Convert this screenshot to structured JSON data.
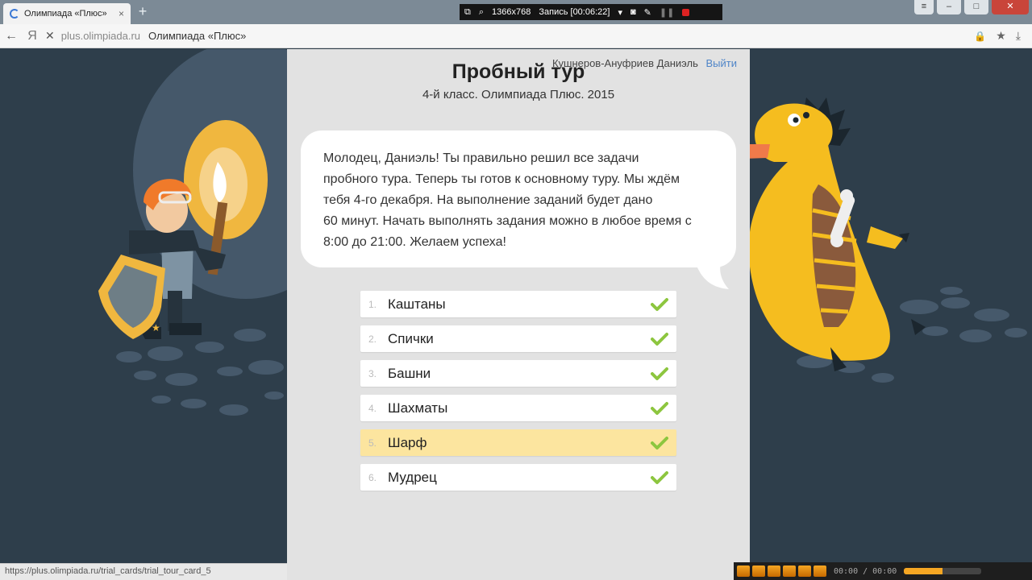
{
  "browser": {
    "tab_title": "Олимпиада «Плюс»",
    "tab_close": "×",
    "new_tab": "+",
    "url_domain": "plus.olimpiada.ru",
    "url_title": "Олимпиада «Плюс»",
    "yandex_letter": "Я",
    "status_url": "https://plus.olimpiada.ru/trial_cards/trial_tour_card_5"
  },
  "recorder": {
    "resolution": "1366x768",
    "recording": "Запись [00:06:22]"
  },
  "page": {
    "title": "Пробный тур",
    "subtitle": "4-й класс. Олимпиада Плюс. 2015",
    "user_name": "Кушнеров-Ануфриев Даниэль",
    "logout": "Выйти",
    "message_lines": [
      "Молодец, Даниэль! Ты правильно решил все задачи",
      "пробного тура. Теперь ты готов к основному туру. Мы ждём",
      "тебя 4-го декабря. На выполнение заданий будет дано",
      "60 минут. Начать выполнять задания можно в любое время с",
      "8:00 до 21:00. Желаем успеха!"
    ],
    "tasks": [
      {
        "num": "1.",
        "name": "Каштаны"
      },
      {
        "num": "2.",
        "name": "Спички"
      },
      {
        "num": "3.",
        "name": "Башни"
      },
      {
        "num": "4.",
        "name": "Шахматы"
      },
      {
        "num": "5.",
        "name": "Шарф"
      },
      {
        "num": "6.",
        "name": "Мудрец"
      }
    ]
  },
  "player": {
    "time": "00:00 / 00:00"
  },
  "colors": {
    "background": "#2e3e4b",
    "panel": "#e2e2e2",
    "highlight": "#fce59f",
    "check": "#8dc63f",
    "link": "#4f85c8"
  }
}
